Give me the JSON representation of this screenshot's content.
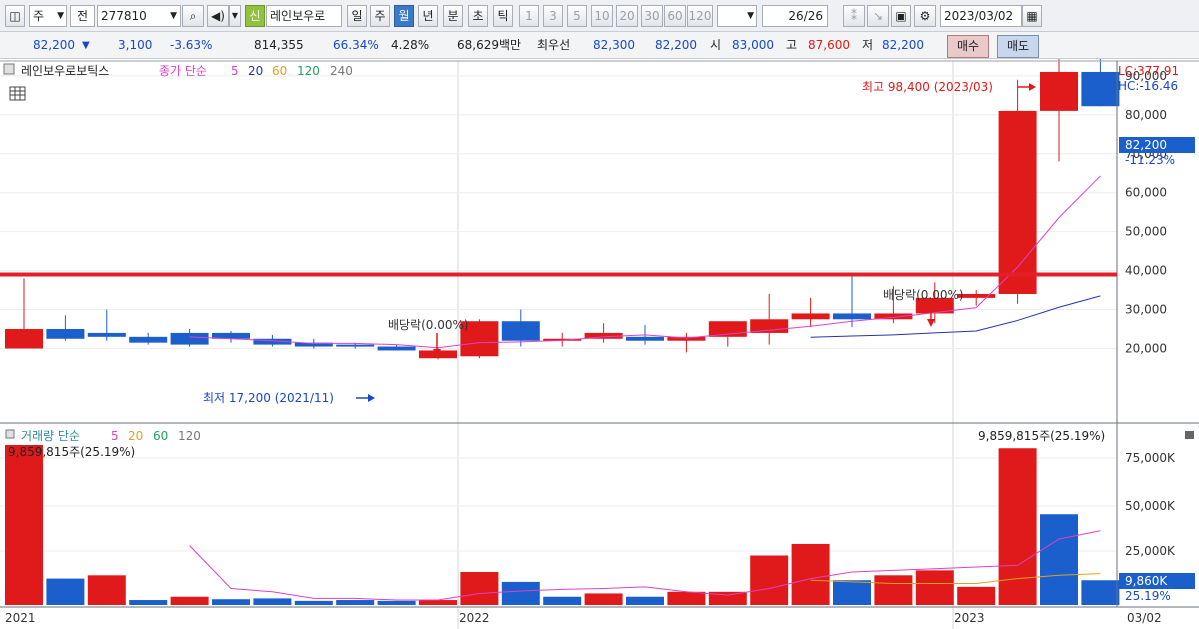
{
  "toolbar": {
    "period_select": "주",
    "market_select": "전",
    "stock_code": "277810",
    "badge": "신",
    "stock_name": "레인보우로",
    "periods": [
      "일",
      "주",
      "월",
      "년",
      "분",
      "초",
      "틱"
    ],
    "active_period": "월",
    "minute_intervals": [
      "1",
      "3",
      "5",
      "10",
      "20",
      "30",
      "60",
      "120"
    ],
    "page_current": "26",
    "page_total": "/26",
    "date": "2023/03/02"
  },
  "info": {
    "price": "82,200",
    "arrow": "▼",
    "change": "3,100",
    "change_pct": "-3.63%",
    "volume": "814,355",
    "vol_ratio": "66.34%",
    "turnover": "4.28%",
    "amount": "68,629백만",
    "best_label": "최우선",
    "best_ask": "82,300",
    "best_bid": "82,200",
    "open_label": "시",
    "open": "83,000",
    "high_label": "고",
    "high": "87,600",
    "low_label": "저",
    "low": "82,200",
    "buy": "매수",
    "sell": "매도"
  },
  "price_panel": {
    "name": "레인보우로보틱스",
    "ma_label": "종가 단순",
    "ma_periods": [
      "5",
      "20",
      "60",
      "120",
      "240"
    ],
    "lc": "LC:377.91",
    "hc": "HC:-16.46",
    "current_tag": "82,200",
    "current_pct": "-11.23%",
    "high_annotation": "최고 98,400 (2023/03)",
    "low_annotation": "최저 17,200 (2021/11)",
    "dividend_label": "배당락(0.00%)",
    "y_ticks": [
      "90,000",
      "80,000",
      "70,000",
      "60,000",
      "50,000",
      "40,000",
      "30,000",
      "20,000"
    ]
  },
  "volume_panel": {
    "label": "거래량 단순",
    "ma_periods": [
      "5",
      "20",
      "60",
      "120"
    ],
    "max_left": "9,859,815주(25.19%)",
    "max_right": "9,859,815주(25.19%)",
    "current_tag": "9,860K",
    "current_pct": "25.19%",
    "y_ticks": [
      "75,000K",
      "50,000K",
      "25,000K"
    ]
  },
  "x_labels": [
    "2021",
    "2022",
    "2023",
    "03/02"
  ],
  "colors": {
    "up": "#e01a1a",
    "down": "#1a5fcc",
    "ma5": "#e040c8",
    "ma20": "#2233aa",
    "vma20": "#e0a020",
    "hline": "#e3202a"
  },
  "chart_data": [
    {
      "type": "candlestick",
      "title": "레인보우로보틱스",
      "period": "monthly",
      "months": [
        "2021-01",
        "2021-02",
        "2021-03",
        "2021-04",
        "2021-05",
        "2021-06",
        "2021-07",
        "2021-08",
        "2021-09",
        "2021-10",
        "2021-11",
        "2021-12",
        "2022-01",
        "2022-02",
        "2022-03",
        "2022-04",
        "2022-05",
        "2022-06",
        "2022-07",
        "2022-08",
        "2022-09",
        "2022-10",
        "2022-11",
        "2022-12",
        "2023-01",
        "2023-02",
        "2023-03"
      ],
      "open": [
        20000,
        25000,
        24000,
        23000,
        24000,
        24000,
        22500,
        21500,
        21000,
        20500,
        17500,
        18000,
        27000,
        22000,
        22500,
        23000,
        22000,
        23000,
        24000,
        27500,
        29000,
        27500,
        29000,
        33000,
        34000,
        81000,
        91000
      ],
      "high": [
        38000,
        28500,
        30000,
        24000,
        25000,
        24500,
        23500,
        22500,
        21500,
        21000,
        20000,
        27500,
        30000,
        24000,
        26500,
        26000,
        24000,
        25500,
        34000,
        33000,
        39000,
        36000,
        37000,
        35000,
        89000,
        98000,
        98400
      ],
      "low": [
        20000,
        22000,
        22000,
        21000,
        20500,
        21500,
        20500,
        20000,
        20000,
        19500,
        17200,
        17500,
        20500,
        20500,
        21500,
        21000,
        19000,
        20500,
        21000,
        25500,
        25500,
        26500,
        26500,
        31000,
        31500,
        68000,
        82200
      ],
      "close": [
        25000,
        22500,
        23000,
        21500,
        21000,
        22500,
        21000,
        20500,
        20500,
        19500,
        19500,
        27000,
        22000,
        22500,
        24000,
        22000,
        23000,
        27000,
        27500,
        29000,
        27500,
        29000,
        33000,
        34000,
        81000,
        91000,
        82200
      ],
      "ma5": [
        null,
        null,
        null,
        null,
        23000,
        22500,
        22000,
        21300,
        21300,
        21000,
        20200,
        21500,
        21700,
        22100,
        23000,
        23500,
        22700,
        23700,
        24700,
        25700,
        27000,
        28000,
        29200,
        30500,
        40900,
        53600,
        64300
      ],
      "ma20": [
        null,
        null,
        null,
        null,
        null,
        null,
        null,
        null,
        null,
        null,
        null,
        null,
        null,
        null,
        null,
        null,
        null,
        null,
        null,
        22900,
        23200,
        23500,
        24000,
        24500,
        27200,
        30600,
        33500
      ],
      "y_ticks": [
        20000,
        30000,
        40000,
        50000,
        60000,
        70000,
        80000,
        90000
      ],
      "horizontal_line": 39000
    },
    {
      "type": "bar",
      "title": "거래량",
      "values": [
        9859815,
        1600000,
        1800000,
        300000,
        500000,
        350000,
        400000,
        250000,
        300000,
        250000,
        300000,
        2000000,
        1400000,
        500000,
        700000,
        500000,
        800000,
        800000,
        3000000,
        3700000,
        1500000,
        1800000,
        2100000,
        1100000,
        9500000,
        5500000,
        1500000
      ],
      "direction": [
        "up",
        "down",
        "up",
        "down",
        "up",
        "down",
        "down",
        "down",
        "down",
        "down",
        "up",
        "up",
        "down",
        "down",
        "up",
        "down",
        "up",
        "up",
        "up",
        "up",
        "down",
        "up",
        "up",
        "up",
        "up",
        "down",
        "down"
      ],
      "ma5": [
        null,
        null,
        null,
        null,
        3600000,
        1000000,
        800000,
        400000,
        400000,
        300000,
        300000,
        700000,
        850000,
        950000,
        1000000,
        1100000,
        800000,
        600000,
        1000000,
        1600000,
        2000000,
        2100000,
        2200000,
        2300000,
        2400000,
        4000000,
        4500000
      ],
      "ma20": [
        null,
        null,
        null,
        null,
        null,
        null,
        null,
        null,
        null,
        null,
        null,
        null,
        null,
        null,
        null,
        null,
        null,
        null,
        null,
        1500000,
        1400000,
        1300000,
        1300000,
        1300000,
        1600000,
        1800000,
        1900000
      ],
      "y_ticks": [
        25000000,
        50000000,
        75000000
      ]
    }
  ]
}
